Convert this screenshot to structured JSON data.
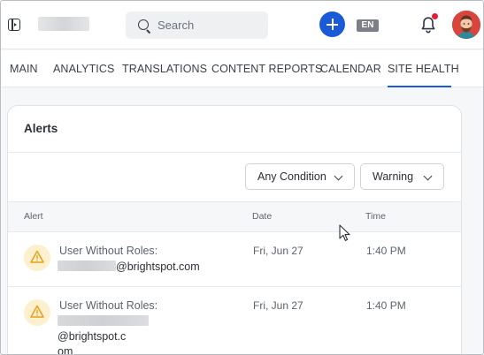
{
  "header": {
    "search_placeholder": "Search",
    "language": "EN",
    "accent_color": "#1a5ad8",
    "notification_dot_color": "#e0203a"
  },
  "tabs": [
    {
      "label": "MAIN",
      "active": false
    },
    {
      "label": "ANALYTICS",
      "active": false
    },
    {
      "label": "TRANSLATIONS",
      "active": false
    },
    {
      "label": "CONTENT REPORTS",
      "active": false
    },
    {
      "label": "CALENDAR",
      "active": false
    },
    {
      "label": "SITE HEALTH",
      "active": true
    }
  ],
  "alerts_card": {
    "title": "Alerts",
    "filters": {
      "condition": "Any Condition",
      "severity": "Warning"
    },
    "columns": [
      "Alert",
      "Date",
      "Time"
    ],
    "rows": [
      {
        "icon": "warning-icon",
        "title": "User Without Roles:",
        "email_suffix": "@brightspot.com",
        "email_suffix_wrap": "",
        "date": "Fri, Jun 27",
        "time": "1:40 PM"
      },
      {
        "icon": "warning-icon",
        "title": "User Without Roles:",
        "email_suffix": "@brightspot.c",
        "email_suffix_wrap": "om",
        "date": "Fri, Jun 27",
        "time": "1:40 PM"
      }
    ]
  }
}
